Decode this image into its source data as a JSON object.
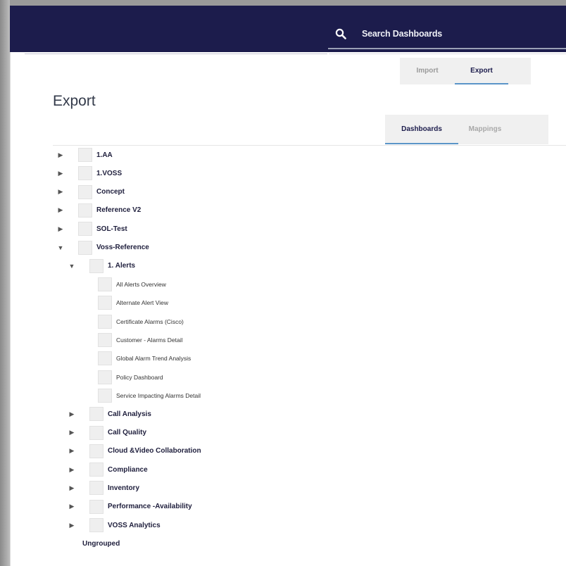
{
  "search": {
    "placeholder": "Search Dashboards",
    "icon": "search-icon"
  },
  "top_tabs": [
    {
      "label": "Import",
      "active": false
    },
    {
      "label": "Export",
      "active": true
    }
  ],
  "page_title": "Export",
  "sub_tabs": [
    {
      "label": "Dashboards",
      "active": true
    },
    {
      "label": "Mappings",
      "active": false
    }
  ],
  "tree": [
    {
      "label": "1.AA",
      "level": 0,
      "expander": "collapsed"
    },
    {
      "label": "1.VOSS",
      "level": 0,
      "expander": "collapsed"
    },
    {
      "label": "Concept",
      "level": 0,
      "expander": "collapsed"
    },
    {
      "label": "Reference V2",
      "level": 0,
      "expander": "collapsed"
    },
    {
      "label": "SOL-Test",
      "level": 0,
      "expander": "collapsed"
    },
    {
      "label": "Voss-Reference",
      "level": 0,
      "expander": "expanded"
    },
    {
      "label": "1. Alerts",
      "level": 1,
      "expander": "expanded"
    },
    {
      "label": "All Alerts Overview",
      "level": 2,
      "expander": "none"
    },
    {
      "label": "Alternate Alert View",
      "level": 2,
      "expander": "none"
    },
    {
      "label": "Certificate Alarms (Cisco)",
      "level": 2,
      "expander": "none"
    },
    {
      "label": "Customer - Alarms Detail",
      "level": 2,
      "expander": "none"
    },
    {
      "label": "Global Alarm Trend Analysis",
      "level": 2,
      "expander": "none"
    },
    {
      "label": "Policy Dashboard",
      "level": 2,
      "expander": "none"
    },
    {
      "label": "Service Impacting Alarms Detail",
      "level": 2,
      "expander": "none"
    },
    {
      "label": "Call Analysis",
      "level": 1,
      "expander": "collapsed"
    },
    {
      "label": "Call Quality",
      "level": 1,
      "expander": "collapsed"
    },
    {
      "label": "Cloud &Video Collaboration",
      "level": 1,
      "expander": "collapsed"
    },
    {
      "label": "Compliance",
      "level": 1,
      "expander": "collapsed"
    },
    {
      "label": "Inventory",
      "level": 1,
      "expander": "collapsed"
    },
    {
      "label": "Performance -Availability",
      "level": 1,
      "expander": "collapsed"
    },
    {
      "label": "VOSS Analytics",
      "level": 1,
      "expander": "collapsed"
    },
    {
      "label": "Ungrouped",
      "level": 0,
      "expander": "none",
      "checkbox": false
    }
  ]
}
